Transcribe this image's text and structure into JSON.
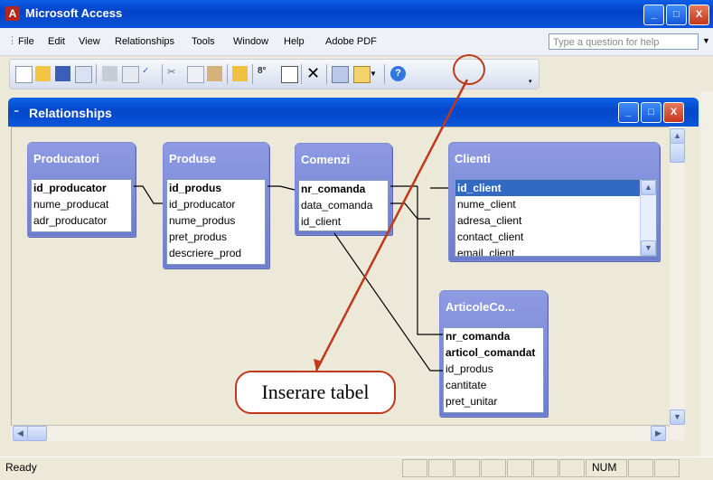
{
  "window": {
    "title": "Microsoft Access",
    "minimize_glyph": "_",
    "maximize_glyph": "□",
    "close_glyph": "X"
  },
  "menu": {
    "items": [
      "File",
      "Edit",
      "View",
      "Relationships",
      "Tools",
      "Window",
      "Help",
      "Adobe PDF"
    ],
    "help_placeholder": "Type a question for help"
  },
  "toolbar": {
    "icons": [
      "new-icon",
      "open-icon",
      "save-icon",
      "search-icon",
      "print-icon",
      "print-preview-icon",
      "spelling-icon",
      "cut-icon",
      "copy-icon",
      "paste-icon",
      "show-table-icon",
      "direct-relationships-icon",
      "all-relationships-icon",
      "delete-icon",
      "database-window-icon",
      "new-object-icon",
      "help-icon"
    ]
  },
  "relationships_window": {
    "title": "Relationships"
  },
  "tables": [
    {
      "name": "Producatori",
      "fields": [
        "id_producator",
        "nume_producat",
        "adr_producator"
      ],
      "pk": [
        0
      ]
    },
    {
      "name": "Produse",
      "fields": [
        "id_produs",
        "id_producator",
        "nume_produs",
        "pret_produs",
        "descriere_prod"
      ],
      "pk": [
        0
      ]
    },
    {
      "name": "Comenzi",
      "fields": [
        "nr_comanda",
        "data_comanda",
        "id_client"
      ],
      "pk": [
        0
      ]
    },
    {
      "name": "Clienti",
      "fields": [
        "id_client",
        "nume_client",
        "adresa_client",
        "contact_client",
        "email_client"
      ],
      "pk": [
        0
      ],
      "selected": 0
    },
    {
      "name": "ArticoleCo...",
      "fields": [
        "nr_comanda",
        "articol_comandat",
        "id_produs",
        "cantitate",
        "pret_unitar"
      ],
      "pk": [
        0,
        1
      ]
    }
  ],
  "annotation": {
    "callout": "Inserare tabel",
    "color": "#c0391b"
  },
  "status": {
    "ready": "Ready",
    "num": "NUM"
  },
  "colors": {
    "titlebar": "#0a53d8",
    "table_header": "#7f8cd8",
    "selection": "#316ac5"
  }
}
